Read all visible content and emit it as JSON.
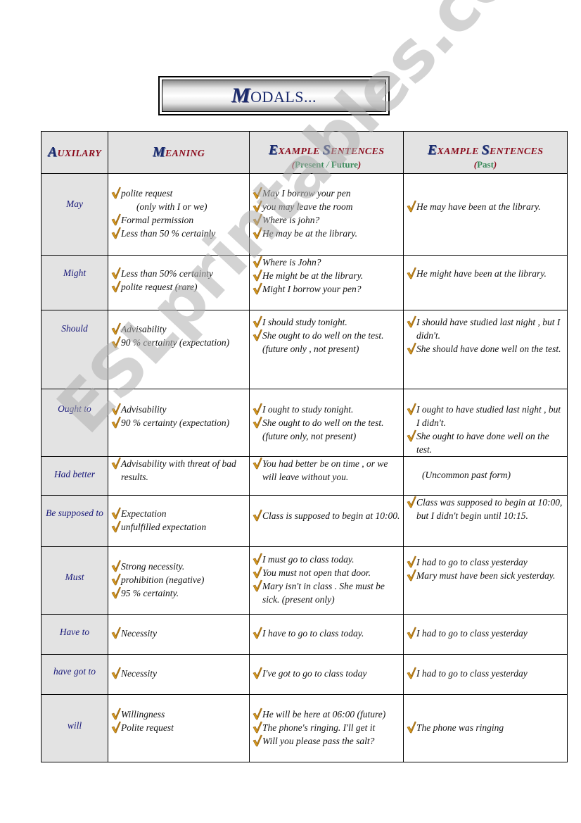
{
  "document": {
    "title_initial": "M",
    "title_rest": "ODALS..."
  },
  "table": {
    "headers": [
      {
        "initial": "A",
        "rest": "UXILARY"
      },
      {
        "initial": "M",
        "rest": "EANING"
      },
      {
        "initial1": "E",
        "rest1": "XAMPLE ",
        "initial2": "S",
        "rest2": "ENTENCES",
        "sub_open": "(",
        "sub_a": "Present",
        "sub_sep": " / ",
        "sub_b": "Future",
        "sub_close": ")"
      },
      {
        "initial1": "E",
        "rest1": "XAMPLE ",
        "initial2": "S",
        "rest2": "ENTENCES",
        "sub_open": "(",
        "sub_a": "Past",
        "sub_close": ")"
      }
    ],
    "rows": [
      {
        "auxiliary": "May",
        "meaning": [
          "polite request",
          "(only with I or we)",
          "Formal permission",
          "Less than  50 % certainly"
        ],
        "present": [
          "May I borrow your pen",
          "you may leave the room",
          "Where is john?",
          "He may be at the library."
        ],
        "past": [
          "He may have  been at the library."
        ]
      },
      {
        "auxiliary": "Might",
        "meaning": [
          "Less than 50% certainty",
          "polite request (rare)"
        ],
        "present": [
          "Where is John?",
          "He might be at the library.",
          "Might I borrow your pen?"
        ],
        "past": [
          "He might have been at the library."
        ]
      },
      {
        "auxiliary": "Should",
        "meaning": [
          "Advisability",
          "90 % certainty (expectation)"
        ],
        "present": [
          "I should study tonight.",
          "She ought to do well on the test. (future only , not present)"
        ],
        "past": [
          "I should have studied last night , but I didn't.",
          "She should have done well on the test."
        ]
      },
      {
        "auxiliary": "Ought to",
        "meaning": [
          "Advisability",
          "90 % certainty (expectation)"
        ],
        "present": [
          "I ought to study tonight.",
          "She ought to do well on the test. (future only, not present)"
        ],
        "past": [
          "I ought to have studied last night , but I didn't.",
          "She ought to have done well on the test."
        ]
      },
      {
        "auxiliary": "Had better",
        "meaning": [
          "Advisability with threat of bad results."
        ],
        "present": [
          "You had better be on time , or we will leave without you."
        ],
        "past_note": "(Uncommon past form)"
      },
      {
        "auxiliary": "Be supposed to",
        "meaning": [
          "Expectation",
          "unfulfilled expectation"
        ],
        "present": [
          "Class is supposed to begin at 10:00."
        ],
        "past": [
          "Class was supposed to begin  at 10:00,  but I didn't begin  until 10:15."
        ]
      },
      {
        "auxiliary": "Must",
        "meaning": [
          "Strong necessity.",
          "prohibition (negative)",
          "95 % certainty."
        ],
        "present": [
          "I must go to class today.",
          "You must not open that door.",
          "Mary isn't in class .  She must be sick.  (present only)"
        ],
        "past": [
          "I had to go to class yesterday",
          "Mary must have been sick yesterday."
        ]
      },
      {
        "auxiliary": "Have to",
        "meaning": [
          "Necessity"
        ],
        "present": [
          "I have to go to class today."
        ],
        "past": [
          "I had to go to class yesterday"
        ]
      },
      {
        "auxiliary": "have got to",
        "meaning": [
          "Necessity"
        ],
        "present": [
          "I've got to go to class today"
        ],
        "past": [
          "I had to go to class yesterday"
        ]
      },
      {
        "auxiliary": "will",
        "meaning": [
          "Willingness",
          "Polite request"
        ],
        "present": [
          "He will be here at 06:00 (future)",
          "The phone's ringing. I'll get it",
          "Will you please pass the salt?"
        ],
        "past": [
          "The phone was ringing"
        ]
      }
    ]
  },
  "icons": {
    "bullet": "checkmark-icon"
  },
  "colors": {
    "header_bg": "#e3e3e3",
    "aux_bg": "#e3e3e3",
    "title_blue": "#1a2a6c",
    "header_red": "#8b0d1e",
    "header_green": "#3a8a5a",
    "aux_text": "#1a1a7a",
    "check_gold": "#d89a1e"
  },
  "watermark": "ESLprintables.com"
}
